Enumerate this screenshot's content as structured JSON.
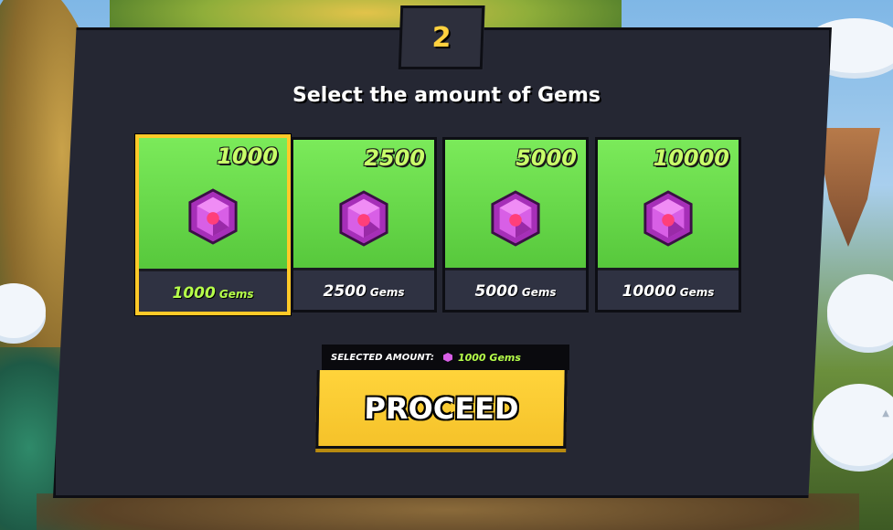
{
  "step": "2",
  "title": "Select the amount of Gems",
  "options": [
    {
      "amount": "1000",
      "label_num": "1000",
      "label_unit": "Gems",
      "selected": true
    },
    {
      "amount": "2500",
      "label_num": "2500",
      "label_unit": "Gems",
      "selected": false
    },
    {
      "amount": "5000",
      "label_num": "5000",
      "label_unit": "Gems",
      "selected": false
    },
    {
      "amount": "10000",
      "label_num": "10000",
      "label_unit": "Gems",
      "selected": false
    }
  ],
  "selection": {
    "label": "SELECTED AMOUNT:",
    "value": "1000 Gems"
  },
  "proceed_label": "PROCEED",
  "icons": {
    "gem": "gem-icon",
    "arrow": "triangle-up-icon"
  },
  "colors": {
    "panel": "#252733",
    "card_green": "#6fdd4f",
    "accent_yellow": "#ffc928",
    "amount_text": "#c9ff6a",
    "gem_purple": "#c94bd6"
  }
}
